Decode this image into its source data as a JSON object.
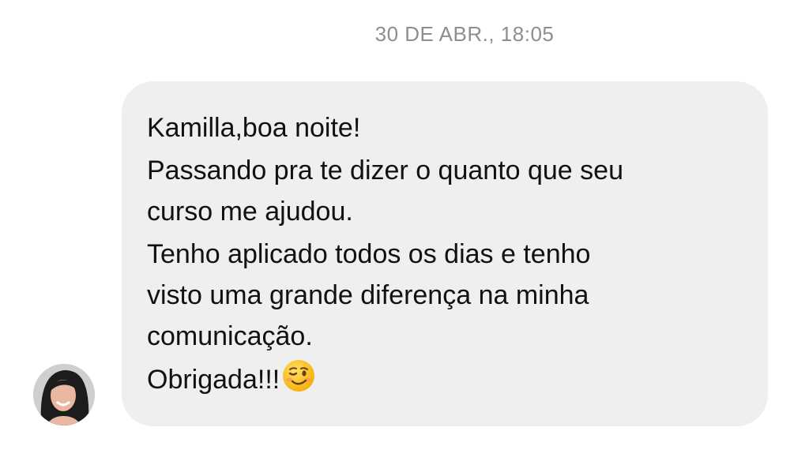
{
  "conversation": {
    "timestamp": "30 DE ABR., 18:05",
    "message": {
      "lines": [
        "Kamilla,boa noite!",
        "Passando pra te dizer o quanto que seu",
        "curso me ajudou.",
        "Tenho aplicado todos os dias e tenho",
        "visto uma grande diferença na minha",
        "comunicação.",
        "Obrigada!!!"
      ],
      "trailing_emoji": "winking-face-icon"
    },
    "sender_avatar": "avatar"
  },
  "colors": {
    "bubble_background": "#efefef",
    "timestamp_text": "#8e8e8e",
    "message_text": "#111111"
  }
}
